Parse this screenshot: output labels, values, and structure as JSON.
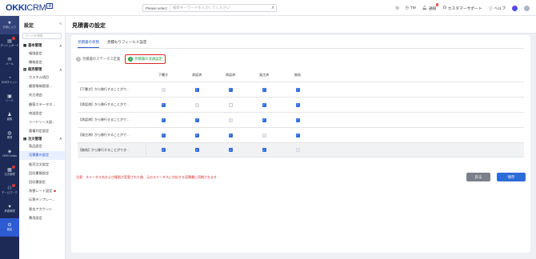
{
  "topbar": {
    "logo_main": "OKKI",
    "logo_sub": "CRM",
    "logo_badge": "企",
    "search_select": "Please select",
    "search_placeholder": "検索キーワードを入力してください",
    "items": [
      {
        "icon": "target-icon",
        "label": ""
      },
      {
        "icon": "clock-icon",
        "label": "TM"
      },
      {
        "icon": "bell-icon",
        "label": "通知",
        "badge": "1"
      },
      {
        "icon": "headset-icon",
        "label": "カスタマーサポート"
      },
      {
        "icon": "help-icon",
        "label": "ヘルプ"
      }
    ],
    "accent": "#2d5bd1"
  },
  "leftnav": [
    {
      "icon": "star-icon",
      "label": "お気に入り",
      "badge": false
    },
    {
      "icon": "dashboard-icon",
      "label": "ダッシュボード",
      "badge": true
    },
    {
      "icon": "mail-icon",
      "label": "メール",
      "badge": false
    },
    {
      "icon": "chat-icon",
      "label": "SNSチャット",
      "badge": false
    },
    {
      "icon": "lead-icon",
      "label": "リード",
      "badge": false
    },
    {
      "icon": "customer-icon",
      "label": "顧客",
      "badge": false
    },
    {
      "icon": "globe-icon",
      "label": "開発",
      "badge": false
    },
    {
      "icon": "okki-icon",
      "label": "OKKI Leads",
      "badge": false
    },
    {
      "icon": "order-icon",
      "label": "注文管理",
      "badge": true
    },
    {
      "icon": "team-icon",
      "label": "チームワーク",
      "badge": true
    },
    {
      "icon": "approval-icon",
      "label": "承認管理",
      "badge": false
    },
    {
      "icon": "settings-icon",
      "label": "設定",
      "badge": false,
      "active": true
    }
  ],
  "sidebar": {
    "title": "設定",
    "search_placeholder": "ページを検索",
    "groups": [
      {
        "label": "基本管理",
        "icon": "grid-icon",
        "items": [
          {
            "label": "権限設定"
          },
          {
            "label": "職務設定"
          }
        ]
      },
      {
        "label": "販売管理",
        "icon": "cart-icon",
        "items": [
          {
            "label": "カスタム項目"
          },
          {
            "label": "顧客情報管理..."
          },
          {
            "label": "失注理由"
          },
          {
            "label": "顧客ステータス..."
          },
          {
            "label": "商談設定"
          },
          {
            "label": "リードソース設..."
          },
          {
            "label": "重複判定設定"
          }
        ]
      },
      {
        "label": "注文管理",
        "icon": "list-icon",
        "items": [
          {
            "label": "製品設定"
          },
          {
            "label": "見積書の設定",
            "active": true
          },
          {
            "label": "販売注文設定"
          },
          {
            "label": "回収書類設定"
          },
          {
            "label": "回収書設定"
          },
          {
            "label": "為替レート設定",
            "dot": true
          },
          {
            "label": "伝票テンプレー..."
          },
          {
            "label": "資金アカウント"
          },
          {
            "label": "費用設定"
          }
        ]
      }
    ]
  },
  "page": {
    "title": "見積書の設定",
    "tabs": [
      {
        "label": "見積書の状態",
        "active": true
      },
      {
        "label": "見積もりフィールド設定",
        "active": false
      }
    ],
    "steps": [
      {
        "num": "1",
        "label": "見積書のステータス定義",
        "current": false
      },
      {
        "num": "2",
        "label": "見積書の流通設定",
        "current": true
      }
    ],
    "table": {
      "columns": [
        "下書き",
        "承認済",
        "承認済",
        "発注済",
        "無効"
      ],
      "rows": [
        {
          "label": "【下書き】から移行することがで...",
          "states": [
            "dis",
            "on",
            "on",
            "on",
            "on"
          ]
        },
        {
          "label": "【承認済】から移行することがで...",
          "states": [
            "on",
            "dis",
            "off",
            "on",
            "on"
          ]
        },
        {
          "label": "【承認済】から移行することがで...",
          "states": [
            "on",
            "on",
            "dis",
            "on",
            "on"
          ]
        },
        {
          "label": "【発注済】から移行することがで...",
          "states": [
            "on",
            "on",
            "on",
            "dis",
            "on"
          ]
        },
        {
          "label": "【無効】から移行することができ...",
          "states": [
            "on",
            "on",
            "on",
            "on",
            "dis"
          ]
        }
      ]
    },
    "note": "注意：ステータス名および権限が変更された後、元のステータスに対応する見積書に同期されます",
    "back_label": "戻る",
    "save_label": "保存"
  }
}
